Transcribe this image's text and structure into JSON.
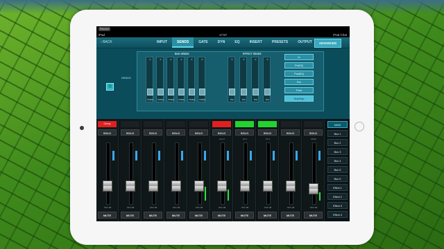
{
  "status_bar": {
    "record_label": "Record",
    "device": "iPad",
    "time": "17:57",
    "camera_label": "iPad Chat"
  },
  "nav": {
    "back_label": "BACK",
    "tabs": [
      "INPUT",
      "SENDS",
      "GATE",
      "DYN",
      "EQ",
      "INSERT",
      "PRESETS",
      "OUTPUT"
    ],
    "active_tab": "SENDS",
    "advanced_label": "ADVANCED"
  },
  "sends_panel": {
    "section_label": "SENDS",
    "bus_group_title": "BUS SENDS",
    "effect_group_title": "EFFECT SENDS",
    "bus_faders": [
      {
        "label": "PostEQ",
        "value": "0"
      },
      {
        "label": "PostEQ",
        "value": "0"
      },
      {
        "label": "PostEQ",
        "value": "0"
      },
      {
        "label": "PostEQ",
        "value": "0"
      },
      {
        "label": "PostEQ",
        "value": "0"
      },
      {
        "label": "PostEQ",
        "value": "0"
      }
    ],
    "effect_faders": [
      {
        "label": "Post",
        "value": "0"
      },
      {
        "label": "Post",
        "value": "0"
      },
      {
        "label": "Post",
        "value": "0"
      },
      {
        "label": "Post",
        "value": "0"
      }
    ],
    "source_options": [
      "In",
      "PreEQ",
      "PostEQ",
      "Pre",
      "Post",
      "Sub/Grp"
    ],
    "selected_source": "Sub/Grp"
  },
  "channels": [
    {
      "name": "Overly",
      "color": "red",
      "label": "",
      "meter": 0.0,
      "fader": 0.72
    },
    {
      "name": "",
      "color": "none",
      "label": "",
      "meter": 0.0,
      "fader": 0.72
    },
    {
      "name": "",
      "color": "none",
      "label": "",
      "meter": 0.0,
      "fader": 0.72
    },
    {
      "name": "",
      "color": "none",
      "label": "",
      "meter": 0.0,
      "fader": 0.72
    },
    {
      "name": "",
      "color": "none",
      "label": "",
      "meter": 0.25,
      "fader": 0.72
    },
    {
      "name": "",
      "color": "red",
      "label": "Aux 2",
      "meter": 0.2,
      "fader": 0.72
    },
    {
      "name": "",
      "color": "green",
      "label": "FX 1",
      "meter": 0.0,
      "fader": 0.72
    },
    {
      "name": "",
      "color": "green",
      "label": "FX 2",
      "meter": 0.0,
      "fader": 0.72
    },
    {
      "name": "",
      "color": "none",
      "label": "",
      "meter": 0.0,
      "fader": 0.72
    },
    {
      "name": "",
      "color": "none",
      "label": "MAIN",
      "meter": 0.15,
      "fader": 0.76
    }
  ],
  "channel_controls": {
    "solo_label": "SOLO",
    "mute_label": "MUTE",
    "off_label": "OFF dB"
  },
  "bus_selector": [
    "MAIN",
    "Bus 1",
    "Bus 2",
    "Bus 3",
    "Bus 4",
    "Bus 5",
    "Bus 6",
    "Effect 1",
    "Effect 2",
    "Effect 3",
    "Effect 4"
  ],
  "bus_selected": "MAIN"
}
